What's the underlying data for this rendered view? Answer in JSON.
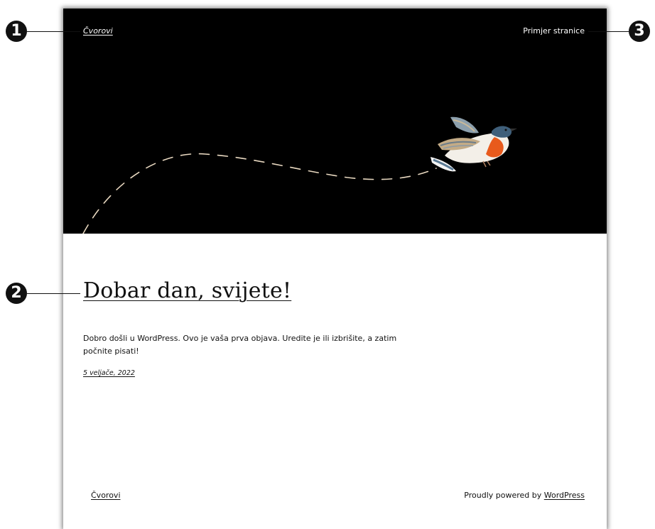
{
  "site": {
    "title": "Čvorovi",
    "nav": [
      {
        "label": "Primjer stranice"
      }
    ]
  },
  "post": {
    "title": "Dobar dan, svijete!",
    "excerpt": "Dobro došli u WordPress. Ovo je vaša prva objava. Uredite je ili izbrišite, a zatim počnite pisati!",
    "date": "5 veljače, 2022"
  },
  "footer": {
    "site_title": "Čvorovi",
    "credit_prefix": "Proudly powered by ",
    "credit_link": "WordPress"
  },
  "callouts": [
    "1",
    "2",
    "3"
  ],
  "colors": {
    "header_bg": "#000000",
    "path_dash": "#e8d8c0",
    "bird_breast": "#e85a1c"
  }
}
